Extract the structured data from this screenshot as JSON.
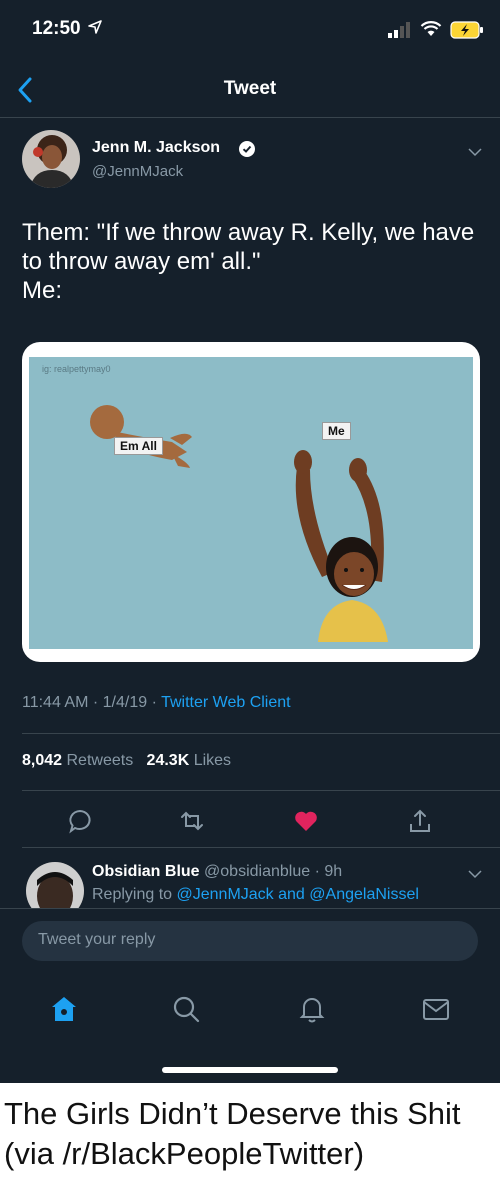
{
  "status_bar": {
    "time": "12:50"
  },
  "nav": {
    "title": "Tweet"
  },
  "author": {
    "name": "Jenn M. Jackson",
    "handle": "@JennMJack"
  },
  "tweet": {
    "lines": [
      "Them: \"If we throw away R. Kelly, we have",
      "to throw away em' all.\"",
      "Me:"
    ]
  },
  "media": {
    "watermark": "ig: realpettymay0",
    "label_left": "Em All",
    "label_right": "Me"
  },
  "meta": {
    "time": "11:44 AM",
    "separator1": "·",
    "date": "1/4/19",
    "separator2": "·",
    "client": "Twitter Web Client"
  },
  "stats": {
    "retweets_count": "8,042",
    "retweets_label": "Retweets",
    "likes_count": "24.3K",
    "likes_label": "Likes"
  },
  "reply": {
    "name": "Obsidian Blue",
    "handle_time": "@obsidianblue · 9h",
    "replying_prefix": "Replying to",
    "mention1": "@JennMJack",
    "and": "and",
    "mention2": "@AngelaNissel"
  },
  "compose": {
    "placeholder": "Tweet your reply"
  },
  "caption": "The Girls Didn’t Deserve this Shit (via /r/BlackPeopleTwitter)",
  "colors": {
    "background": "#15202b",
    "accent": "#1da1f2",
    "like": "#e0245e",
    "divider": "#38444d"
  }
}
